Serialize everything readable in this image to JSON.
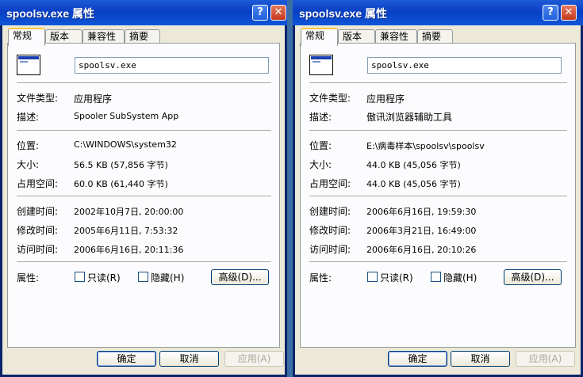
{
  "windows": [
    {
      "title": "spoolsv.exe 属性",
      "help_icon": "?",
      "close_icon": "✕",
      "tabs": [
        "常规",
        "版本",
        "兼容性",
        "摘要"
      ],
      "file_name": "spoolsv.exe",
      "type_label": "文件类型:",
      "type_value": "应用程序",
      "desc_label": "描述:",
      "desc_value": "Spooler SubSystem App",
      "location_label": "位置:",
      "location_value": "C:\\WINDOWS\\system32",
      "size_label": "大小:",
      "size_value": "56.5 KB (57,856 字节)",
      "disk_label": "占用空间:",
      "disk_value": "60.0 KB (61,440 字节)",
      "created_label": "创建时间:",
      "created_value": "2002年10月7日, 20:00:00",
      "modified_label": "修改时间:",
      "modified_value": "2005年6月11日, 7:53:32",
      "accessed_label": "访问时间:",
      "accessed_value": "2006年6月16日, 20:11:36",
      "attr_label": "属性:",
      "readonly_label": "只读(R)",
      "hidden_label": "隐藏(H)",
      "advanced_label": "高级(D)...",
      "ok_label": "确定",
      "cancel_label": "取消",
      "apply_label": "应用(A)"
    },
    {
      "title": "spoolsv.exe 属性",
      "help_icon": "?",
      "close_icon": "✕",
      "tabs": [
        "常规",
        "版本",
        "兼容性",
        "摘要"
      ],
      "file_name": "spoolsv.exe",
      "type_label": "文件类型:",
      "type_value": "应用程序",
      "desc_label": "描述:",
      "desc_value": "傲讯浏览器辅助工具",
      "location_label": "位置:",
      "location_value": "E:\\病毒样本\\spoolsv\\spoolsv",
      "size_label": "大小:",
      "size_value": "44.0 KB (45,056 字节)",
      "disk_label": "占用空间:",
      "disk_value": "44.0 KB (45,056 字节)",
      "created_label": "创建时间:",
      "created_value": "2006年6月16日, 19:59:30",
      "modified_label": "修改时间:",
      "modified_value": "2006年3月21日, 16:49:00",
      "accessed_label": "访问时间:",
      "accessed_value": "2006年6月16日, 20:10:26",
      "attr_label": "属性:",
      "readonly_label": "只读(R)",
      "hidden_label": "隐藏(H)",
      "advanced_label": "高级(D)...",
      "ok_label": "确定",
      "cancel_label": "取消",
      "apply_label": "应用(A)"
    }
  ]
}
